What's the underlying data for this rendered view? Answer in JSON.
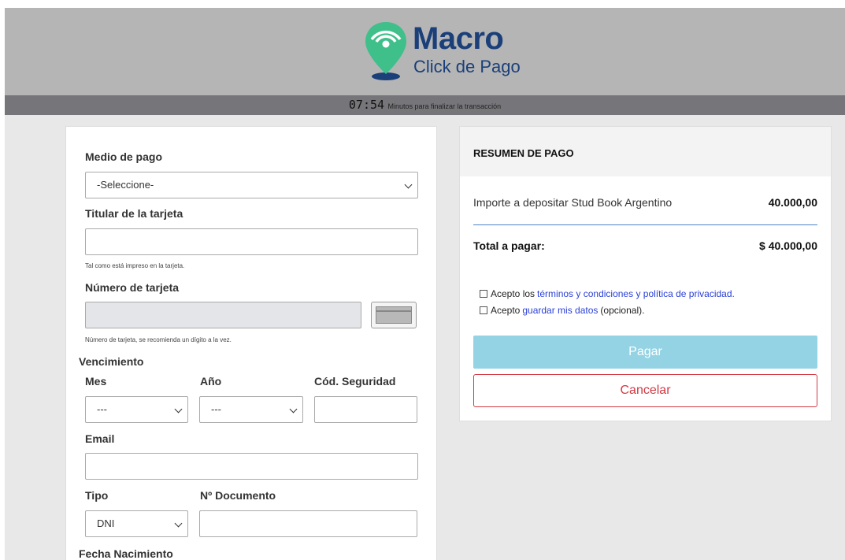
{
  "brand": {
    "name": "Macro",
    "subtitle": "Click de Pago",
    "colors": {
      "navy": "#1a3f79",
      "green": "#3fbf8a",
      "header_bg": "#b5b5b5",
      "timer_bg": "#76767a"
    }
  },
  "timer": {
    "value": "07:54",
    "text": "Minutos para finalizar la transacción"
  },
  "form": {
    "medio_pago": {
      "label": "Medio de pago",
      "value": "-Seleccione-"
    },
    "titular": {
      "label": "Titular de la tarjeta",
      "value": "",
      "hint": "Tal como está impreso en la tarjeta."
    },
    "numero": {
      "label": "Número de tarjeta",
      "value": "",
      "hint": "Número de tarjeta, se recomienda un dígito a la vez.",
      "icon": "credit-card-icon"
    },
    "vencimiento_label": "Vencimiento",
    "mes": {
      "label": "Mes",
      "value": "---"
    },
    "anio": {
      "label": "Año",
      "value": "---"
    },
    "cvv": {
      "label": "Cód. Seguridad",
      "value": ""
    },
    "email": {
      "label": "Email",
      "value": ""
    },
    "tipo": {
      "label": "Tipo",
      "value": "DNI"
    },
    "documento": {
      "label": "Nº Documento",
      "value": ""
    },
    "fecha_nacimiento_label": "Fecha Nacimiento"
  },
  "summary": {
    "title": "RESUMEN DE PAGO",
    "item_label": "Importe a depositar Stud Book Argentino",
    "item_amount": "40.000,00",
    "total_label": "Total a pagar:",
    "total_amount": "$ 40.000,00",
    "terms": {
      "prefix": "Acepto los",
      "link": "términos y condiciones y política de privacidad."
    },
    "save": {
      "prefix": "Acepto",
      "link": "guardar mis datos",
      "suffix": "(opcional)."
    },
    "pay_button": "Pagar",
    "cancel_button": "Cancelar"
  }
}
